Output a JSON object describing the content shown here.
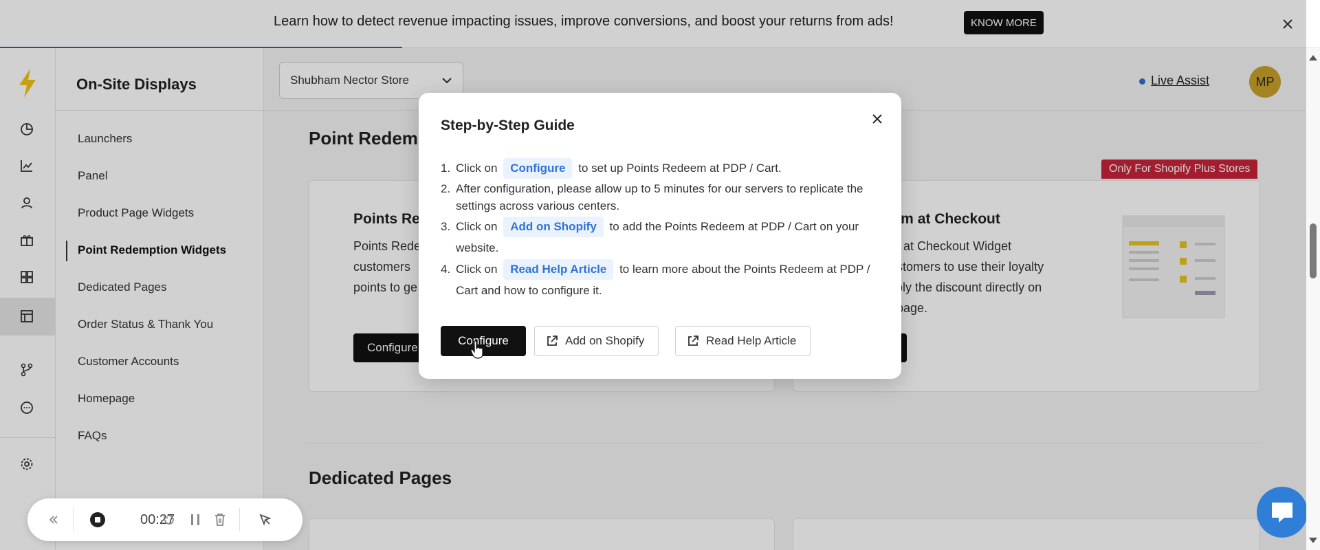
{
  "banner": {
    "text": "Learn how to detect revenue impacting issues, improve conversions, and boost your returns from ads!",
    "button_label": "KNOW MORE"
  },
  "rail": {
    "icons": [
      "bolt-logo",
      "analytics-pie-icon",
      "trend-chart-icon",
      "user-icon",
      "gift-icon",
      "widgets-icon",
      "displays-icon",
      "flow-icon",
      "chat-icon",
      "settings-icon"
    ]
  },
  "subnav": {
    "title": "On-Site Displays",
    "items": [
      {
        "label": "Launchers"
      },
      {
        "label": "Panel"
      },
      {
        "label": "Product Page Widgets"
      },
      {
        "label": "Point Redemption Widgets",
        "active": true
      },
      {
        "label": "Dedicated Pages"
      },
      {
        "label": "Order Status & Thank You"
      },
      {
        "label": "Customer Accounts"
      },
      {
        "label": "Homepage"
      },
      {
        "label": "FAQs"
      }
    ]
  },
  "header": {
    "store": "Shubham Nector Store",
    "live_assist": "Live Assist",
    "avatar_initials": "MP"
  },
  "main": {
    "section1_title": "Point Redemp",
    "card1": {
      "title": "Points Re",
      "lines": [
        "Points Rede",
        "customers",
        "points to ge"
      ],
      "button": "Configure"
    },
    "card2": {
      "badge": "Only For Shopify Plus Stores",
      "title": "deem at Checkout",
      "lines": [
        "eem at Checkout Widget",
        "r customers to use their loyalty",
        "l apply the discount directly on",
        "out page."
      ],
      "button": "e"
    },
    "section2_title": "Dedicated Pages"
  },
  "modal": {
    "title": "Step-by-Step Guide",
    "steps": [
      {
        "num": "1.",
        "pre": "Click on",
        "chip": "Configure",
        "post": "to set up Points Redeem at PDP / Cart."
      },
      {
        "num": "2.",
        "pre": "After configuration, please allow up to 5 minutes for our servers to replicate the settings across various centers.",
        "chip": "",
        "post": ""
      },
      {
        "num": "3.",
        "pre": "Click on",
        "chip": "Add on Shopify",
        "post": "to add the Points Redeem at PDP / Cart on your website."
      },
      {
        "num": "4.",
        "pre": "Click on",
        "chip": "Read Help Article",
        "post": "to learn more about the Points Redeem at PDP / Cart and how to configure it."
      }
    ],
    "buttons": {
      "configure": "Configure",
      "add_on_shopify": "Add on Shopify",
      "read_help": "Read Help Article"
    }
  },
  "recorder": {
    "time": "00:27"
  },
  "colors": {
    "accent_blue": "#2f72d6",
    "badge_red": "#c9243a",
    "avatar_gold": "#c8a12a",
    "logo_yellow": "#f2c318"
  }
}
